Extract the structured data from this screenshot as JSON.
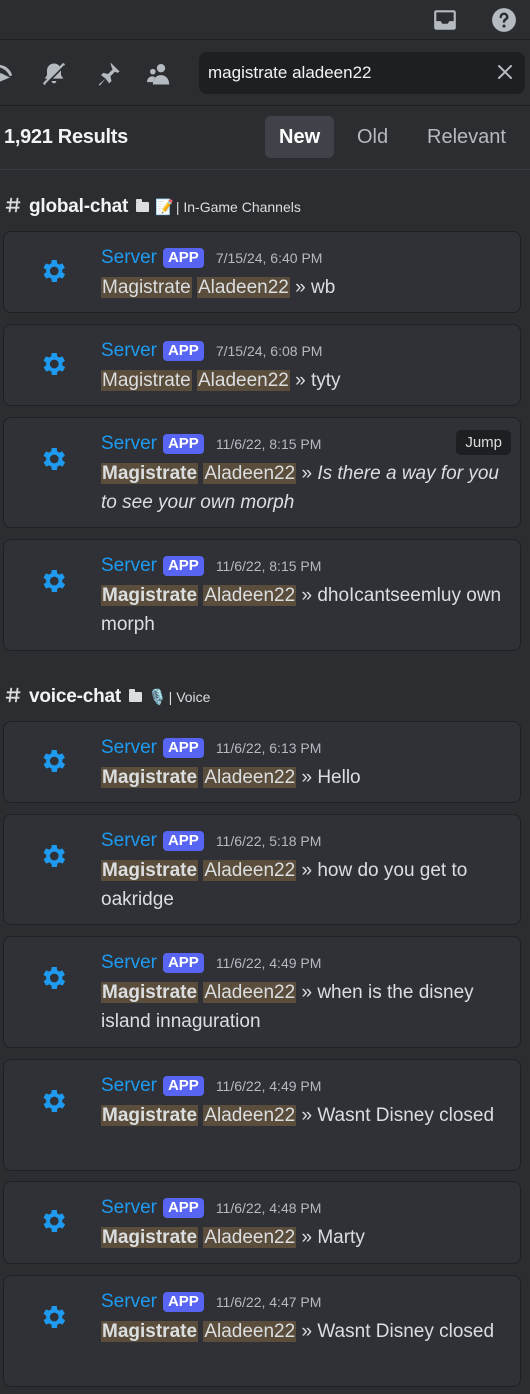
{
  "topbar": {
    "inbox_icon": "inbox-icon",
    "help_icon": "help-icon"
  },
  "toolbar": {
    "icons": [
      "threads-icon",
      "mute-bell-icon",
      "pin-icon",
      "member-list-icon"
    ]
  },
  "search": {
    "value": "magistrate aladeen22",
    "clear_icon": "close-icon"
  },
  "results": {
    "count": "1,921 Results",
    "sort": {
      "new": "New",
      "old": "Old",
      "relevant": "Relevant",
      "active": "New"
    }
  },
  "groups": [
    {
      "channel": "global-chat",
      "emoji": "📝",
      "category": "| In-Game Channels"
    },
    {
      "channel": "voice-chat",
      "emoji": "🎙️",
      "category": "| Voice"
    }
  ],
  "sep": "»",
  "messages": [
    {
      "user": "Server",
      "badge": "APP",
      "time": "7/15/24, 6:40 PM",
      "w1": "Magistrate",
      "w2": "Aladeen22",
      "text": "wb"
    },
    {
      "user": "Server",
      "badge": "APP",
      "time": "7/15/24, 6:08 PM",
      "w1": "Magistrate",
      "w2": "Aladeen22",
      "text": "tyty"
    },
    {
      "user": "Server",
      "badge": "APP",
      "time": "11/6/22, 8:15 PM",
      "w1": "Magistrate",
      "w2": "Aladeen22",
      "text": "Is there a way for you to see your own morph",
      "jump": "Jump"
    },
    {
      "user": "Server",
      "badge": "APP",
      "time": "11/6/22, 8:15 PM",
      "w1": "Magistrate",
      "w2": "Aladeen22",
      "text": "dhoIcantseemluy own morph"
    },
    {
      "user": "Server",
      "badge": "APP",
      "time": "11/6/22, 6:13 PM",
      "w1": "Magistrate",
      "w2": "Aladeen22",
      "text": "Hello"
    },
    {
      "user": "Server",
      "badge": "APP",
      "time": "11/6/22, 5:18 PM",
      "w1": "Magistrate",
      "w2": "Aladeen22",
      "text": "how do you get to oakridge"
    },
    {
      "user": "Server",
      "badge": "APP",
      "time": "11/6/22, 4:49 PM",
      "w1": "Magistrate",
      "w2": "Aladeen22",
      "text": "when is the disney island innaguration"
    },
    {
      "user": "Server",
      "badge": "APP",
      "time": "11/6/22, 4:49 PM",
      "w1": "Magistrate",
      "w2": "Aladeen22",
      "text": "Wasnt Disney closed"
    },
    {
      "user": "Server",
      "badge": "APP",
      "time": "11/6/22, 4:48 PM",
      "w1": "Magistrate",
      "w2": "Aladeen22",
      "text": "Marty"
    },
    {
      "user": "Server",
      "badge": "APP",
      "time": "11/6/22, 4:47 PM",
      "w1": "Magistrate",
      "w2": "Aladeen22",
      "text": "Wasnt Disney closed"
    }
  ],
  "colors": {
    "accent": "#5865f2",
    "username": "#1e9bf0",
    "highlight": "#5a4d3b",
    "background": "#2b2d31"
  }
}
